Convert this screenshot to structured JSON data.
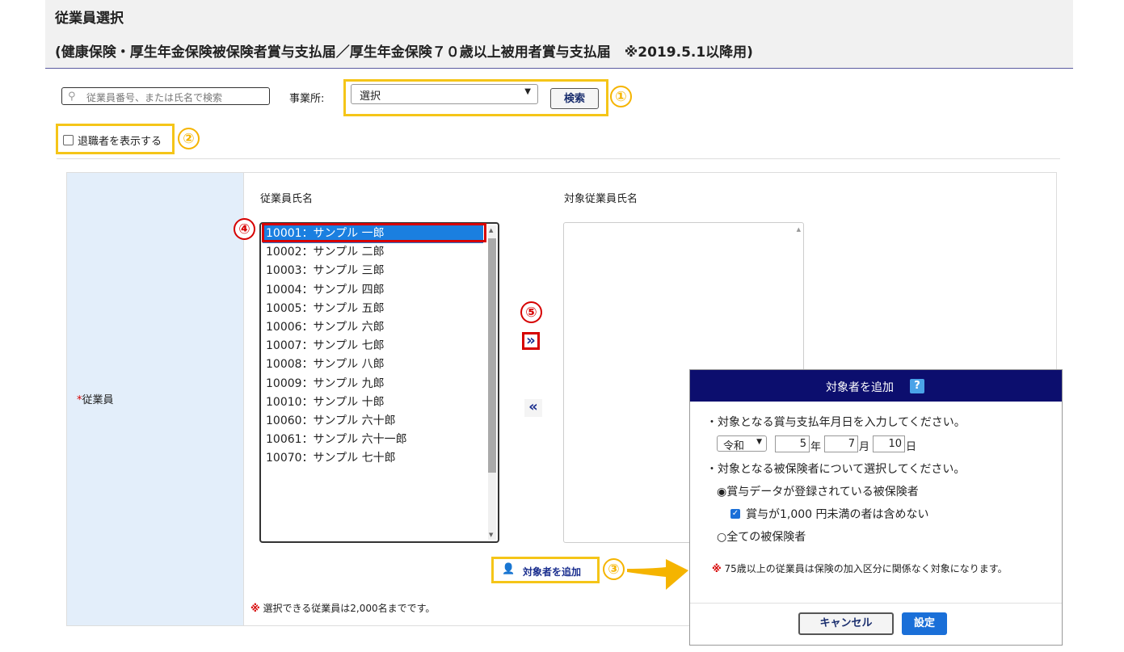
{
  "header": {
    "title": "従業員選択",
    "subtitle": "(健康保険・厚生年金保険被保険者賞与支払届／厚生年金保険７０歳以上被用者賞与支払届　※2019.5.1以降用)"
  },
  "search": {
    "placeholder": "従業員番号、または氏名で検索",
    "icon": "search-icon"
  },
  "office": {
    "label": "事業所:",
    "selected": "選択",
    "search_button": "検索"
  },
  "retired": {
    "label": "退職者を表示する",
    "checked": false
  },
  "callouts": {
    "c1": "①",
    "c2": "②",
    "c3": "③",
    "c4": "④",
    "c5": "⑤"
  },
  "form": {
    "required_mark": "*",
    "field_label": "従業員",
    "col_employees": "従業員氏名",
    "col_targets": "対象従業員氏名",
    "employees": [
      "10001：サンプル 一郎",
      "10002：サンプル 二郎",
      "10003：サンプル 三郎",
      "10004：サンプル 四郎",
      "10005：サンプル 五郎",
      "10006：サンプル 六郎",
      "10007：サンプル 七郎",
      "10008：サンプル 八郎",
      "10009：サンプル 九郎",
      "10010：サンプル 十郎",
      "10060：サンプル 六十郎",
      "10061：サンプル 六十一郎",
      "10070：サンプル 七十郎"
    ],
    "selected_index": 0,
    "move_right": "»",
    "move_left": "«",
    "add_button": "対象者を追加",
    "note_mark": "※",
    "note": "選択できる従業員は2,000名までです。"
  },
  "dialog": {
    "title": "対象者を追加",
    "help": "?",
    "line1": "・対象となる賞与支払年月日を入力してください。",
    "era": "令和",
    "year": "5",
    "year_unit": "年",
    "month": "7",
    "month_unit": "月",
    "day": "10",
    "day_unit": "日",
    "line2": "・対象となる被保険者について選択してください。",
    "radio1": "◉賞与データが登録されている被保険者",
    "checkbox_mark": "✓",
    "checkbox_label": "賞与が1,000 円未満の者は含めない",
    "radio2": "○全ての被保険者",
    "note_mark": "※",
    "note": "75歳以上の従業員は保険の加入区分に関係なく対象になります。",
    "cancel": "キャンセル",
    "ok": "設定"
  },
  "colors": {
    "accent": "#1a6fd8",
    "highlight": "#f5c518",
    "alert": "#d60000",
    "dialog_header": "#0c0e6e",
    "form_label_bg": "#e3eefa"
  }
}
